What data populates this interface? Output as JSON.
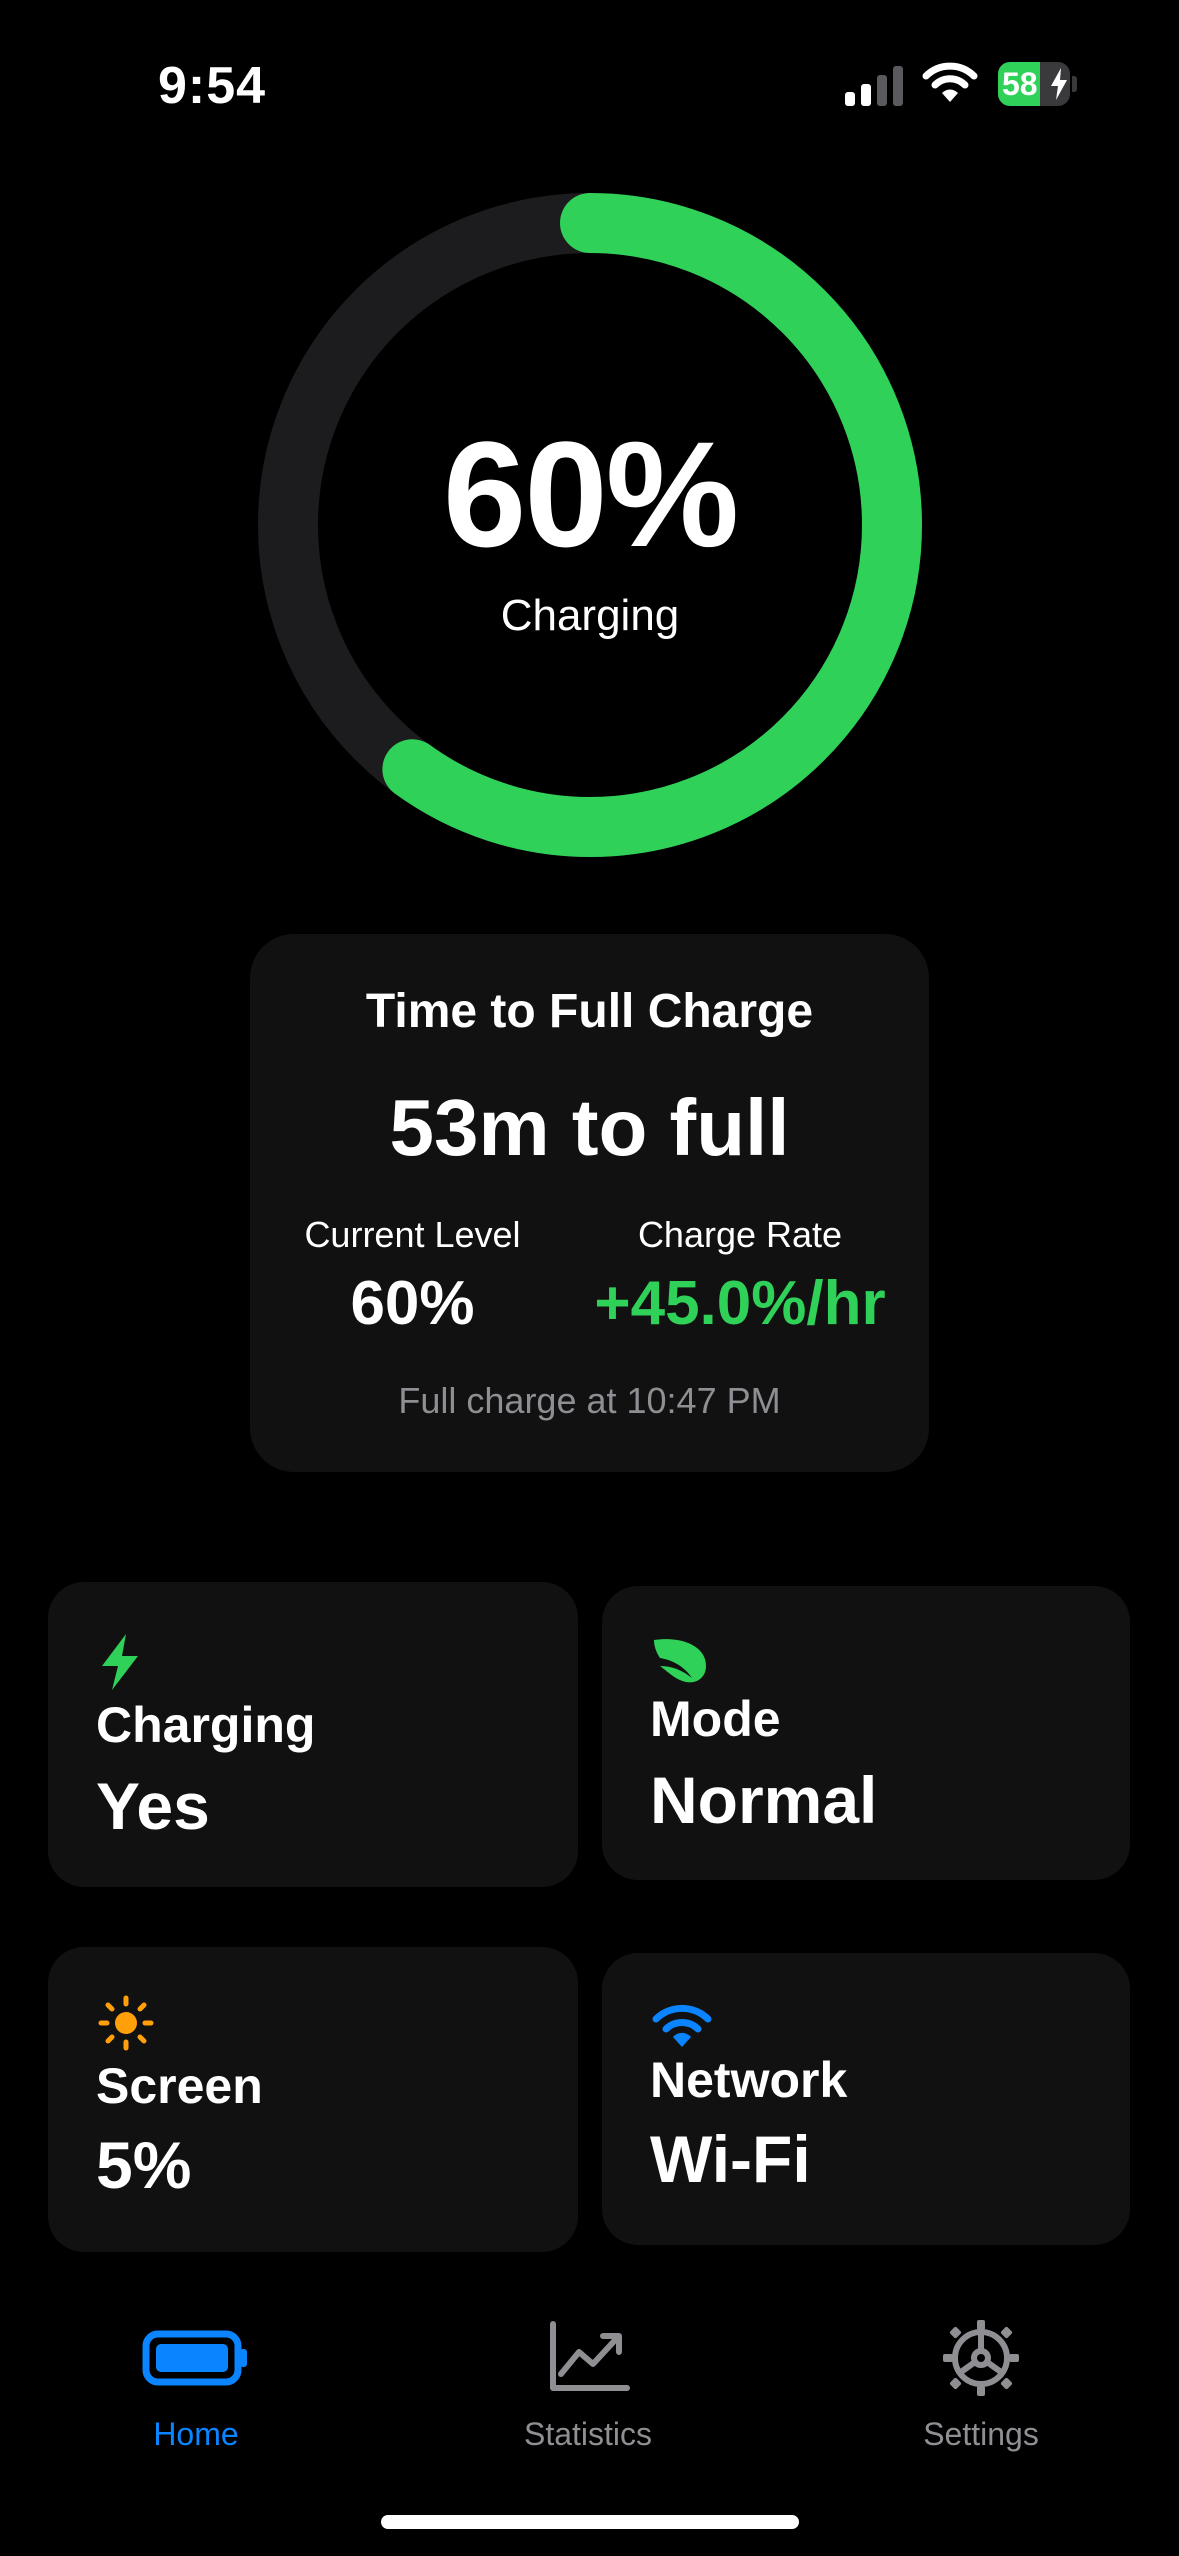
{
  "status_bar": {
    "time": "9:54",
    "battery_percent": "58",
    "battery_level": 0.58,
    "charging": true
  },
  "ring": {
    "percent_text": "60%",
    "status_text": "Charging",
    "level": 0.6,
    "color": "#30d158",
    "track_color": "#1c1c1e"
  },
  "charge_card": {
    "title": "Time to Full Charge",
    "main": "53m to full",
    "current_level_label": "Current Level",
    "current_level_value": "60%",
    "charge_rate_label": "Charge Rate",
    "charge_rate_value": "+45.0%/hr",
    "footer": "Full charge at 10:47 PM"
  },
  "tiles": [
    {
      "label": "Charging",
      "value": "Yes",
      "icon": "bolt-icon",
      "icon_color": "#30d158"
    },
    {
      "label": "Mode",
      "value": "Normal",
      "icon": "leaf-icon",
      "icon_color": "#30d158"
    },
    {
      "label": "Screen",
      "value": "5%",
      "icon": "sun-icon",
      "icon_color": "#ff9f0a"
    },
    {
      "label": "Network",
      "value": "Wi-Fi",
      "icon": "wifi-icon",
      "icon_color": "#0a84ff"
    }
  ],
  "tab_bar": {
    "active_color": "#0a84ff",
    "inactive_color": "#8e8e93",
    "tabs": [
      {
        "label": "Home",
        "icon": "battery-icon",
        "active": true
      },
      {
        "label": "Statistics",
        "icon": "chart-icon",
        "active": false
      },
      {
        "label": "Settings",
        "icon": "gear-icon",
        "active": false
      }
    ]
  }
}
